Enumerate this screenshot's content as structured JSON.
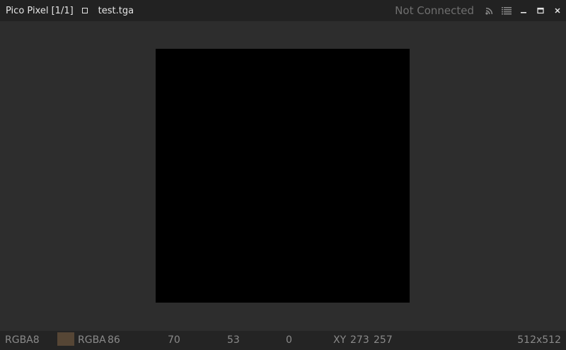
{
  "titlebar": {
    "app_title": "Pico Pixel [1/1]",
    "tab_label": "test.tga",
    "connection_status": "Not Connected",
    "icons": [
      "rss-icon",
      "list-icon",
      "minimize-icon",
      "maximize-icon",
      "close-icon"
    ]
  },
  "statusbar": {
    "format": "RGBA8",
    "swatch_color": "#564635",
    "channel_label": "RGBA",
    "r": "86",
    "g": "70",
    "b": "53",
    "a": "0",
    "xy_label": "XY",
    "x": "273",
    "y": "257",
    "dimensions": "512x512"
  },
  "colors": {
    "titlebar_bg": "#222222",
    "viewport_bg": "#2d2d2d",
    "image_fill": "#000000",
    "statusbar_bg": "#242424"
  }
}
